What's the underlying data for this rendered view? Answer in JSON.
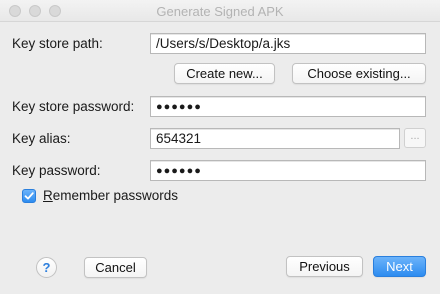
{
  "window": {
    "title": "Generate Signed APK"
  },
  "form": {
    "key_store_path_label": "Key store path:",
    "key_store_path_value": "/Users/s/Desktop/a.jks",
    "create_new_label": "Create new...",
    "choose_existing_label": "Choose existing...",
    "key_store_password_label": "Key store password:",
    "key_store_password_value": "●●●●●●",
    "key_alias_label": "Key alias:",
    "key_alias_value": "654321",
    "key_alias_browse_label": "...",
    "key_password_label": "Key password:",
    "key_password_value": "●●●●●●",
    "remember_passwords_first": "R",
    "remember_passwords_rest": "emember passwords",
    "remember_passwords_checked": true
  },
  "footer": {
    "help_label": "?",
    "cancel_label": "Cancel",
    "previous_label": "Previous",
    "next_label": "Next"
  },
  "colors": {
    "accent": "#2d8cf0",
    "window_bg": "#ececec"
  },
  "icons": {
    "checkmark": "check-icon",
    "help": "help-icon"
  }
}
